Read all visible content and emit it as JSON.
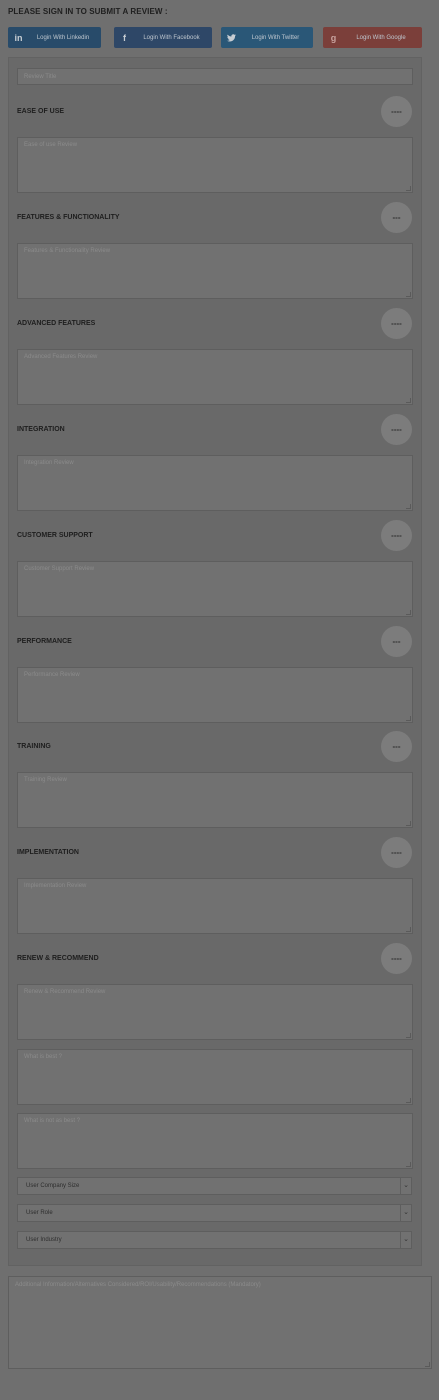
{
  "signin": {
    "header": "PLEASE SIGN IN TO SUBMIT A REVIEW :",
    "buttons": [
      {
        "icon": "linkedin-icon",
        "glyph": "in",
        "label": "Login With Linkedin"
      },
      {
        "icon": "facebook-icon",
        "glyph": "f",
        "label": "Login With Facebook"
      },
      {
        "icon": "twitter-icon",
        "glyph": "t",
        "label": "Login With Twitter"
      },
      {
        "icon": "google-icon",
        "glyph": "g",
        "label": "Login With Google"
      }
    ]
  },
  "form": {
    "review_title_placeholder": "Review Title",
    "sections": [
      {
        "label": "EASE OF USE",
        "rating": "----",
        "placeholder": "Ease of use Review"
      },
      {
        "label": "FEATURES & FUNCTIONALITY",
        "rating": "---",
        "placeholder": "Features & Functionality Review"
      },
      {
        "label": "ADVANCED FEATURES",
        "rating": "----",
        "placeholder": "Advanced Features Review"
      },
      {
        "label": "INTEGRATION",
        "rating": "----",
        "placeholder": "Integration Review"
      },
      {
        "label": "CUSTOMER SUPPORT",
        "rating": "----",
        "placeholder": "Customer Support Review"
      },
      {
        "label": "PERFORMANCE",
        "rating": "---",
        "placeholder": "Performance Review"
      },
      {
        "label": "TRAINING",
        "rating": "---",
        "placeholder": "Training Review"
      },
      {
        "label": "IMPLEMENTATION",
        "rating": "----",
        "placeholder": "Implementation Review"
      },
      {
        "label": "RENEW & RECOMMEND",
        "rating": "----",
        "placeholder": "Renew & Recommend Review"
      }
    ],
    "what_is_best_placeholder": "What is best ?",
    "what_is_not_best_placeholder": "What is not as best ?",
    "selects": [
      {
        "value": "User Company Size"
      },
      {
        "value": "User Role"
      },
      {
        "value": "User Industry"
      }
    ],
    "additional_placeholder": "Additional Information/Alternatives Considered/ROI/Usability/Recommendations (Mandatory)"
  }
}
